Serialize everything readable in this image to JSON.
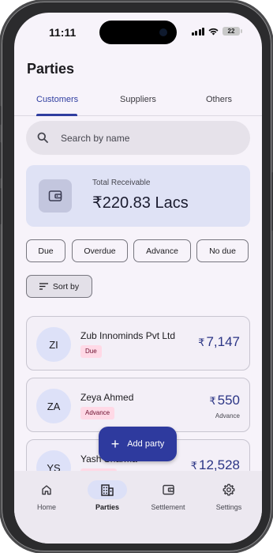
{
  "status": {
    "time": "11:11",
    "battery": "22"
  },
  "page": {
    "title": "Parties"
  },
  "tabs": [
    {
      "label": "Customers",
      "active": true
    },
    {
      "label": "Suppliers",
      "active": false
    },
    {
      "label": "Others",
      "active": false
    }
  ],
  "search": {
    "placeholder": "Search by name"
  },
  "receivable": {
    "label": "Total Receivable",
    "amount": "₹220.83 Lacs"
  },
  "filters": [
    "Due",
    "Overdue",
    "Advance",
    "No due"
  ],
  "sort": {
    "label": "Sort by"
  },
  "parties": [
    {
      "initials": "ZI",
      "name": "Zub Innominds Pvt Ltd",
      "badge": "Due",
      "currency": "₹",
      "amount": "7,147",
      "sub": ""
    },
    {
      "initials": "ZA",
      "name": "Zeya Ahmed",
      "badge": "Advance",
      "currency": "₹",
      "amount": "550",
      "sub": "Advance"
    },
    {
      "initials": "YS",
      "name": "Yash Sharma",
      "badge": "",
      "currency": "₹",
      "amount": "12,528",
      "sub": ""
    }
  ],
  "fab": {
    "label": "Add party"
  },
  "nav": [
    {
      "label": "Home",
      "icon": "home-icon",
      "active": false
    },
    {
      "label": "Parties",
      "icon": "parties-icon",
      "active": true
    },
    {
      "label": "Settlement",
      "icon": "wallet-icon",
      "active": false
    },
    {
      "label": "Settings",
      "icon": "gear-icon",
      "active": false
    }
  ],
  "colors": {
    "accent": "#2e3a9e",
    "card": "#dfe2f5",
    "badge": "#ffd9e6"
  }
}
